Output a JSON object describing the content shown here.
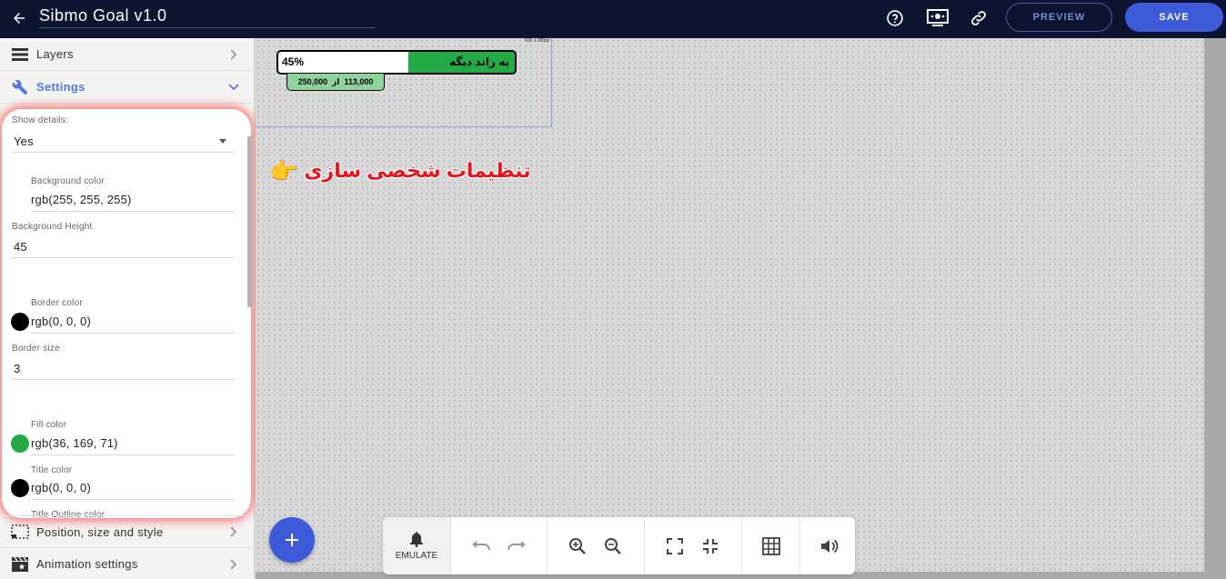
{
  "header": {
    "title": "Sibmo Goal v1.0",
    "preview_label": "PREVIEW",
    "save_label": "SAVE"
  },
  "sidebar": {
    "sections": [
      {
        "label": "Layers",
        "icon": "layers-icon"
      },
      {
        "label": "Settings",
        "icon": "wrench-icon"
      },
      {
        "label": "Position, size and style",
        "icon": "selection-icon"
      },
      {
        "label": "Animation settings",
        "icon": "clapperboard-icon"
      }
    ],
    "settings": {
      "show_details": {
        "label": "Show details:",
        "value": "Yes"
      },
      "background_color": {
        "label": "Background color",
        "value": "rgb(255, 255, 255)",
        "swatch": "#ffffff"
      },
      "background_height": {
        "label": "Background Height",
        "value": "45"
      },
      "border_color": {
        "label": "Border color",
        "value": "rgb(0, 0, 0)",
        "swatch": "#000000"
      },
      "border_size": {
        "label": "Border size",
        "value": "3"
      },
      "fill_color": {
        "label": "Fill color",
        "value": "rgb(36, 169, 71)",
        "swatch": "#24a947"
      },
      "title_color": {
        "label": "Title color",
        "value": "rgb(0, 0, 0)",
        "swatch": "#000000"
      },
      "title_outline_color": {
        "label": "Title Outline color"
      }
    }
  },
  "canvas": {
    "frame_size_label": "600 x 180px",
    "goal": {
      "percent_label": "45%",
      "fill_fraction": 0.45,
      "title": "یه راند دیگه",
      "current": "113,000",
      "separator": "از",
      "target": "250,000"
    },
    "annotation": "تنظیمات شخصی سازی",
    "annotation_emoji": "👉"
  },
  "toolbar": {
    "emulate_label": "EMULATE"
  },
  "colors": {
    "topbar": "#0d1430",
    "accent": "#3d5bd8",
    "fill": "#24a947",
    "annotation": "#e8141c"
  }
}
